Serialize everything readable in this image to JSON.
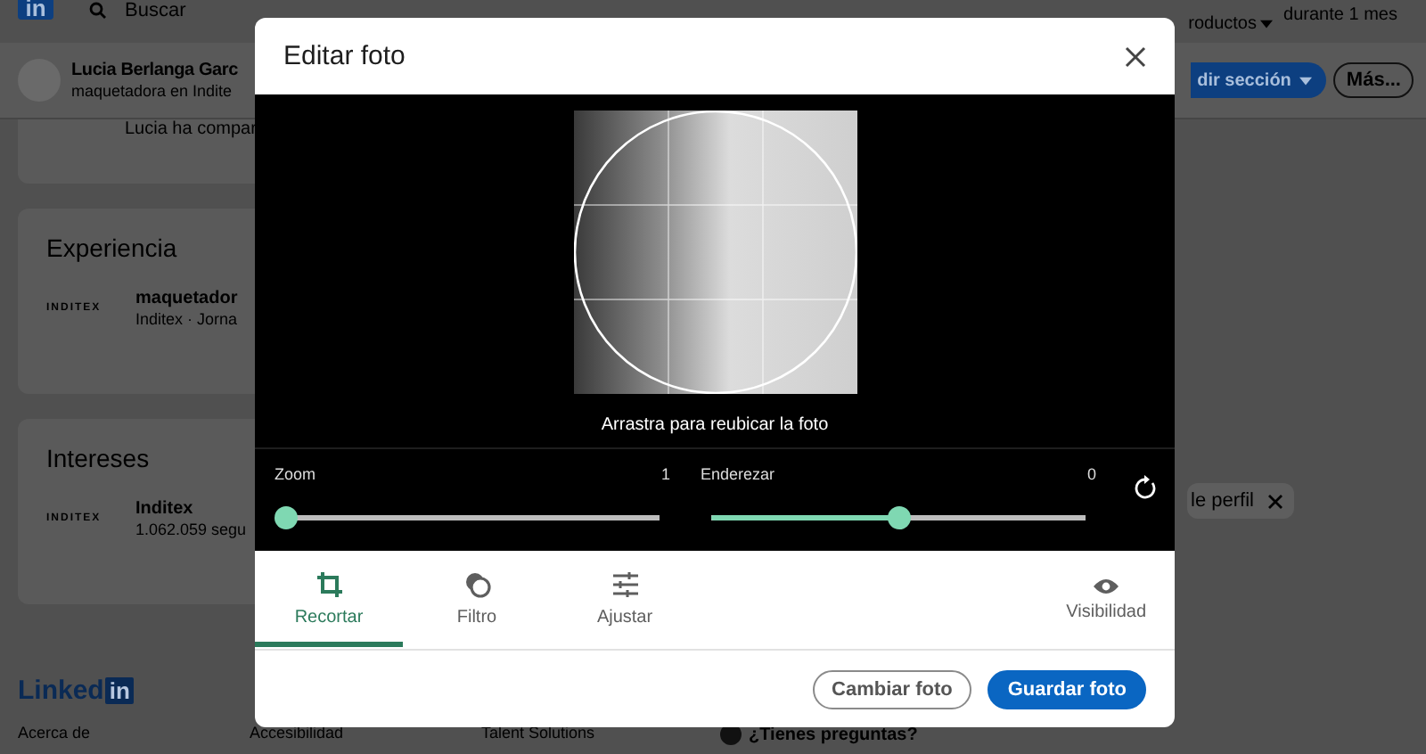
{
  "background": {
    "nav": {
      "logo": "in",
      "search_placeholder": "Buscar",
      "products": "roductos",
      "premium": "durante 1 mes"
    },
    "profile": {
      "name": "Lucia Berlanga Garc",
      "headline": "maquetadora en Indite",
      "actions": [
        {
          "label": "dir sección",
          "kind": "primary"
        },
        {
          "label": "Más...",
          "kind": "secondary"
        }
      ]
    },
    "activity_note": "Lucia ha compar",
    "sections": [
      {
        "title": "Experiencia",
        "entries": [
          {
            "logo": "INDITEX",
            "title": "maquetador",
            "subtitle": "Inditex · Jorna"
          }
        ]
      },
      {
        "title": "Intereses",
        "entries": [
          {
            "logo": "INDITEX",
            "title": "Inditex",
            "subtitle": "1.062.059 segu"
          }
        ]
      }
    ],
    "chip": {
      "label": "le perfil"
    },
    "footer": {
      "logo": {
        "text": "Linked",
        "badge": "in"
      },
      "links": [
        "Acerca de",
        "Accesibilidad",
        "Talent Solutions"
      ],
      "help": "¿Tienes preguntas?"
    }
  },
  "dialog": {
    "title": "Editar foto",
    "hint": "Arrastra para reubicar la foto",
    "sliders": [
      {
        "label": "Zoom",
        "reading": "1",
        "level": 0
      },
      {
        "label": "Enderezar",
        "reading": "0",
        "level": 0.5
      }
    ],
    "tabs": [
      {
        "label": "Recortar",
        "selected": true
      },
      {
        "label": "Filtro",
        "selected": false
      },
      {
        "label": "Ajustar",
        "selected": false
      }
    ],
    "visibility": "Visibilidad",
    "buttons": [
      {
        "label": "Cambiar foto",
        "kind": "secondary"
      },
      {
        "label": "Guardar foto",
        "kind": "primary"
      }
    ]
  }
}
